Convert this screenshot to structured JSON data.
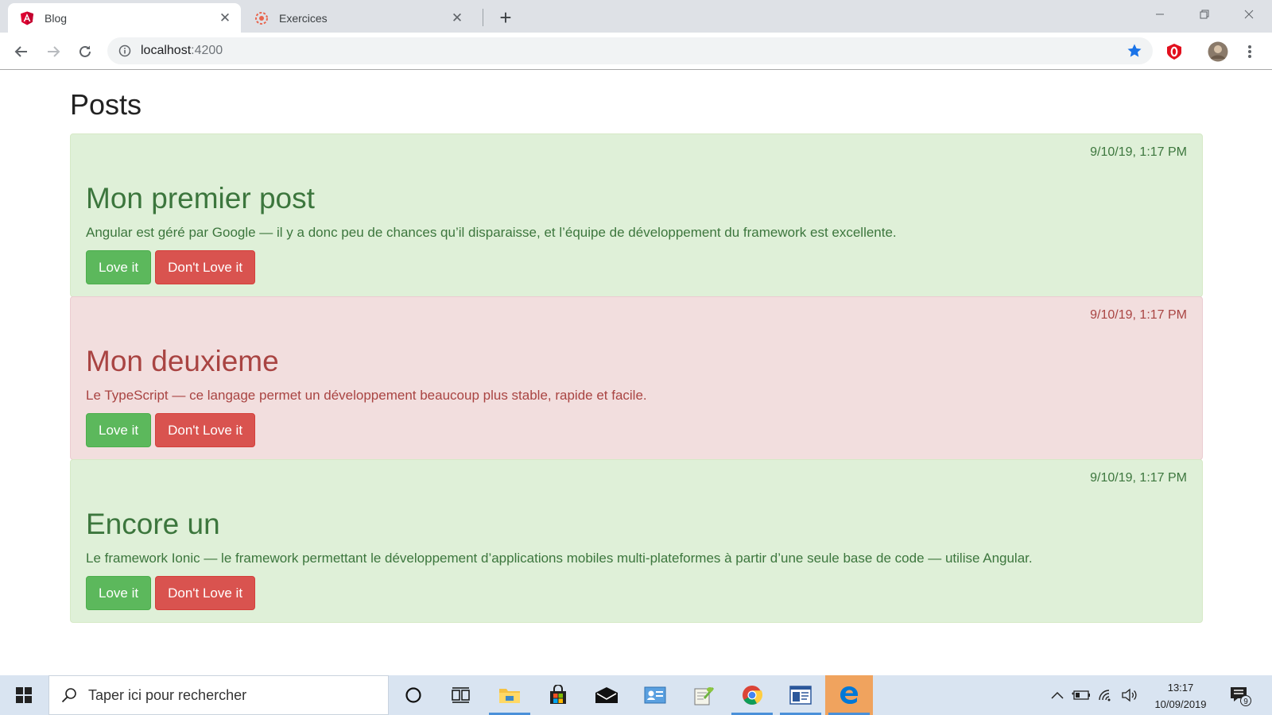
{
  "browser": {
    "tabs": [
      {
        "title": "Blog",
        "icon": "angular-icon",
        "active": true
      },
      {
        "title": "Exercices",
        "icon": "exercises-favicon",
        "active": false
      }
    ],
    "url": {
      "host": "localhost",
      "port": ":4200"
    }
  },
  "page": {
    "heading": "Posts",
    "posts": [
      {
        "date": "9/10/19, 1:17 PM",
        "title": "Mon premier post",
        "content": "Angular est géré par Google — il y a donc peu de chances qu’il disparaisse, et l’équipe de développement du framework est excellente.",
        "love_label": "Love it",
        "dislike_label": "Don't Love it",
        "state": "positive"
      },
      {
        "date": "9/10/19, 1:17 PM",
        "title": "Mon deuxieme",
        "content": "Le TypeScript — ce langage permet un développement beaucoup plus stable, rapide et facile.",
        "love_label": "Love it",
        "dislike_label": "Don't Love it",
        "state": "negative"
      },
      {
        "date": "9/10/19, 1:17 PM",
        "title": "Encore un",
        "content": "Le framework Ionic — le framework permettant le développement d’applications mobiles multi-plateformes à partir d’une seule base de code — utilise Angular.",
        "love_label": "Love it",
        "dislike_label": "Don't Love it",
        "state": "positive"
      }
    ]
  },
  "taskbar": {
    "search_placeholder": "Taper ici pour rechercher",
    "time": "13:17",
    "date": "10/09/2019",
    "notification_count": "9"
  },
  "colors": {
    "positive_bg": "#dff0d8",
    "negative_bg": "#f2dede",
    "love_button": "#5cb85c",
    "dislike_button": "#d9534f"
  }
}
